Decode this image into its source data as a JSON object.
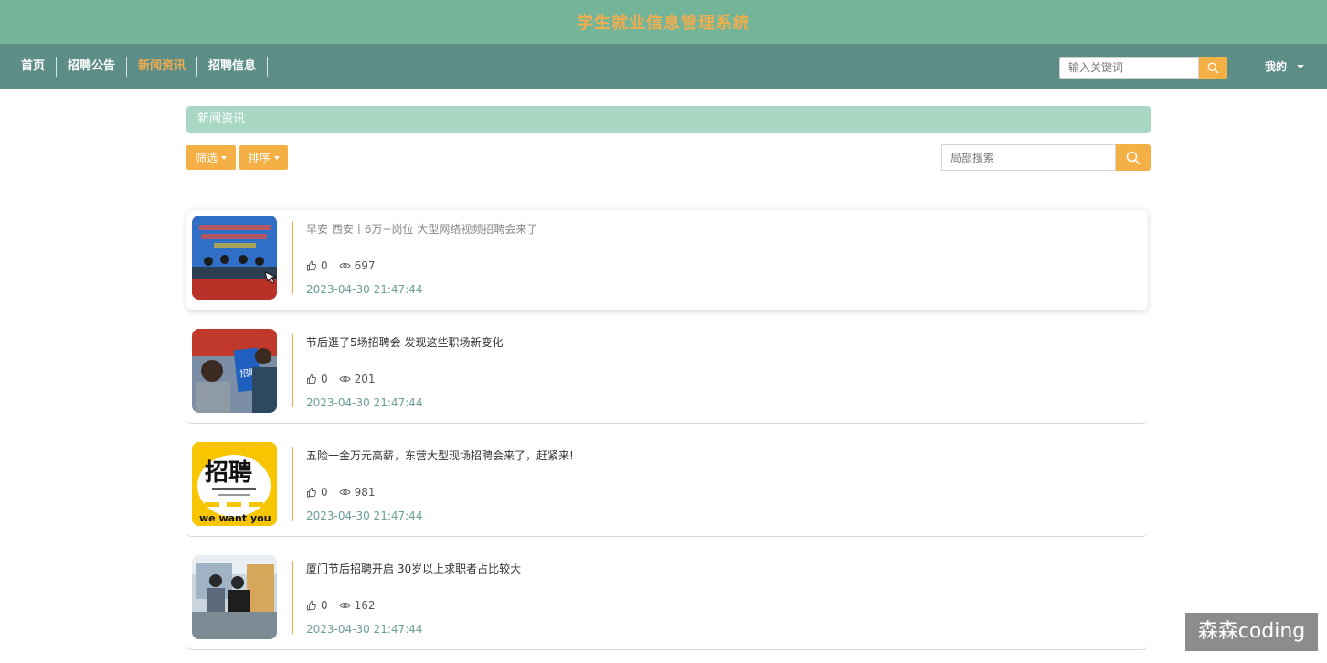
{
  "header": {
    "title": "学生就业信息管理系统",
    "title_color": "#f0ad4e",
    "bg_color": "#74b59a"
  },
  "nav": {
    "items": [
      {
        "label": "首页",
        "active": false
      },
      {
        "label": "招聘公告",
        "active": false
      },
      {
        "label": "新闻资讯",
        "active": true
      },
      {
        "label": "招聘信息",
        "active": false
      }
    ],
    "search_placeholder": "输入关键词",
    "me_label": "我的",
    "bg_color": "#5d8d87"
  },
  "section": {
    "title": "新闻资讯",
    "filter_label": "筛选",
    "sort_label": "排序",
    "search_placeholder": "局部搜索"
  },
  "news": [
    {
      "title": "早安 西安丨6万+岗位 大型网络视频招聘会来了",
      "likes": "0",
      "views": "697",
      "date": "2023-04-30 21:47:44",
      "thumb": "job-fair-stage-photo"
    },
    {
      "title": "节后逛了5场招聘会 发现这些职场新变化",
      "likes": "0",
      "views": "201",
      "date": "2023-04-30 21:47:44",
      "thumb": "recruitment-crowd-photo"
    },
    {
      "title": "五险一金万元高薪，东营大型现场招聘会来了，赶紧来!",
      "likes": "0",
      "views": "981",
      "date": "2023-04-30 21:47:44",
      "thumb": "zhaopin-poster"
    },
    {
      "title": "厦门节后招聘开启 30岁以上求职者占比较大",
      "likes": "0",
      "views": "162",
      "date": "2023-04-30 21:47:44",
      "thumb": "office-interview-photo"
    }
  ],
  "watermark": "森森coding",
  "accent_color": "#f4b045"
}
